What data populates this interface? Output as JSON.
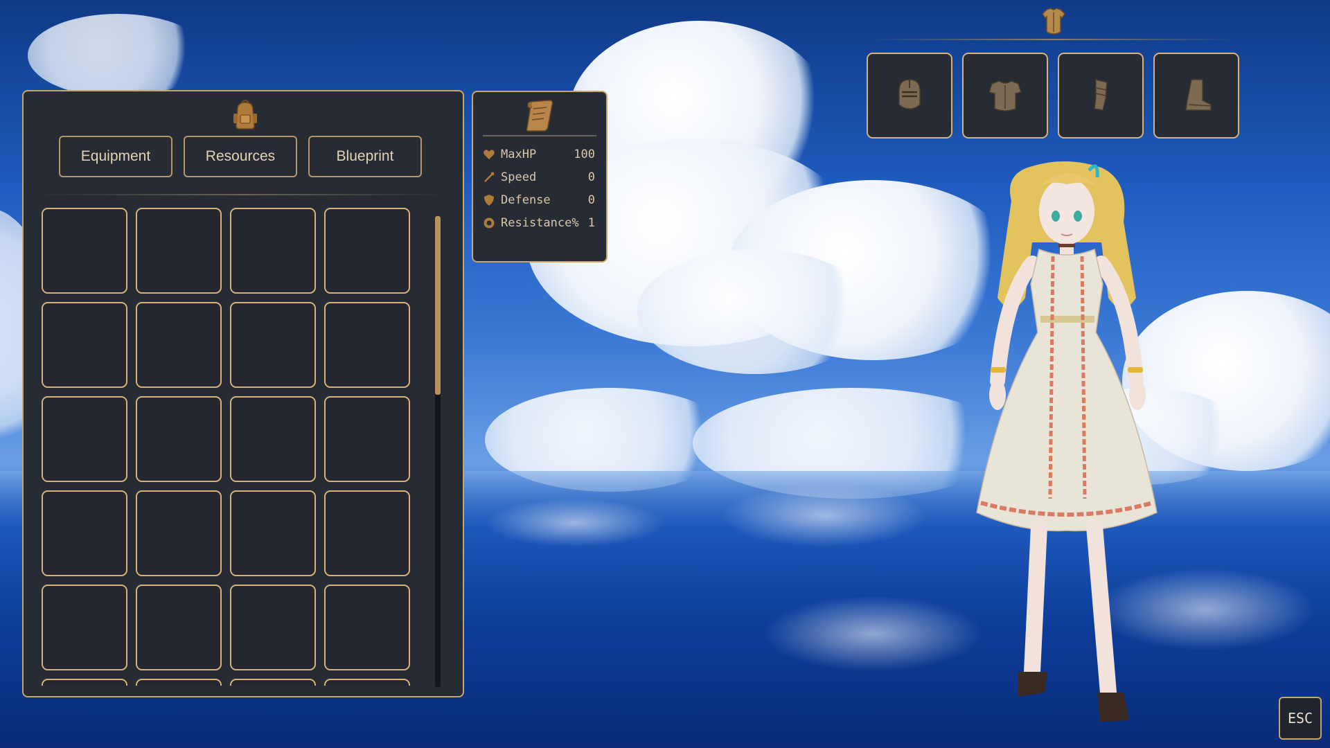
{
  "inventory": {
    "icon": "backpack-icon",
    "tabs": [
      {
        "label": "Equipment"
      },
      {
        "label": "Resources"
      },
      {
        "label": "Blueprint"
      }
    ],
    "visible_rows": 5,
    "columns": 4,
    "scroll_fraction": 0.38
  },
  "stats": {
    "icon": "scroll-icon",
    "rows": [
      {
        "icon": "heart-icon",
        "label": "MaxHP",
        "value": "100"
      },
      {
        "icon": "speed-icon",
        "label": "Speed",
        "value": "0"
      },
      {
        "icon": "shield-icon",
        "label": "Defense",
        "value": "0"
      },
      {
        "icon": "resistance-icon",
        "label": "Resistance%",
        "value": "1"
      }
    ]
  },
  "equipment": {
    "header_icon": "armor-icon",
    "slots": [
      {
        "name": "helmet-icon"
      },
      {
        "name": "chestplate-icon"
      },
      {
        "name": "gauntlet-icon"
      },
      {
        "name": "boot-icon"
      }
    ]
  },
  "esc_label": "ESC",
  "colors": {
    "panel": "#272b34",
    "gold_border": "#d7b37a",
    "text": "#e3d3b2"
  }
}
